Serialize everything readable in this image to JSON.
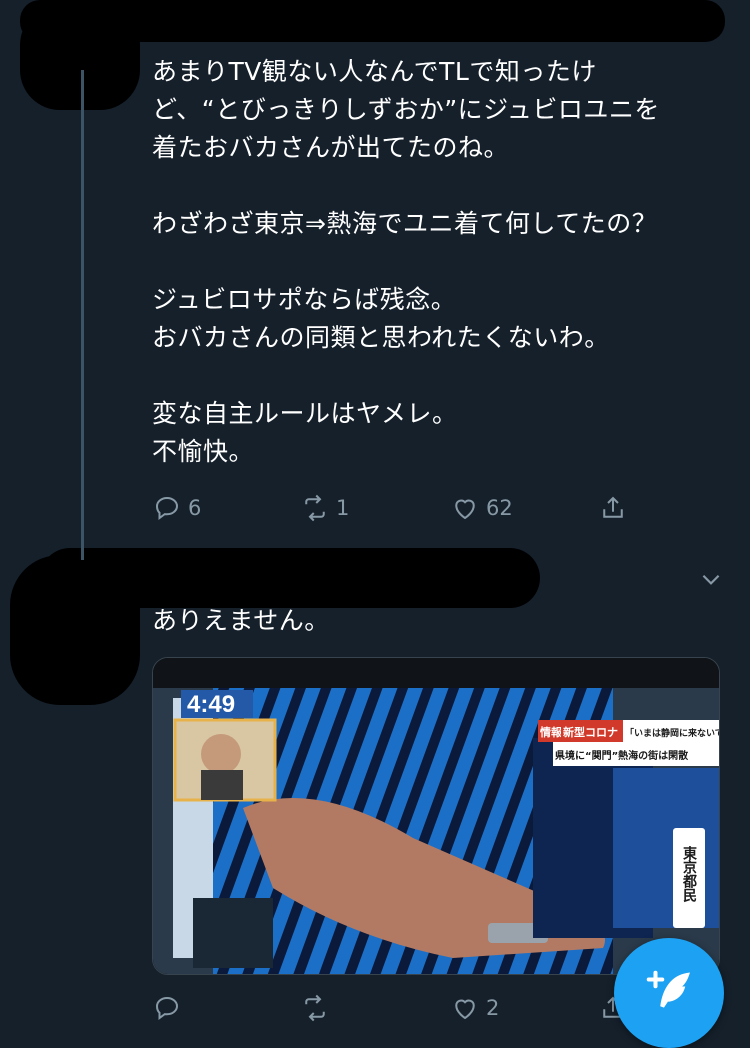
{
  "tweet1": {
    "text": "あまりTV観ない人なんでTLで知ったけ\nど、“とびっきりしずおか”にジュビロユニを\n着たおバカさんが出てたのね。\n\nわざわざ東京⇒熱海でユニ着て何してたの？\n\nジュビロサポならば残念。\nおバカさんの同類と思われたくないわ。\n\n変な自主ルールはヤメレ。\n不愉快。",
    "reply_count": "6",
    "retweet_count": "1",
    "like_count": "62"
  },
  "tweet2": {
    "text": "ありえません。",
    "reply_count": "",
    "retweet_count": "",
    "like_count": "2",
    "media": {
      "clock": "4:49",
      "caption_tag1": "情報",
      "caption_tag2": "新型コロナ",
      "caption_quote": "「いまは静岡に来ないで」",
      "caption_line2": "県境に“関門”熱海の街は閑散",
      "side_label": "東京都民"
    }
  },
  "icons": {
    "reply": "reply-icon",
    "retweet": "retweet-icon",
    "like": "heart-icon",
    "share": "share-icon",
    "more": "chevron-down-icon",
    "compose": "compose-tweet-icon"
  },
  "colors": {
    "background": "#15202b",
    "text": "#ffffff",
    "secondary": "#8899a6",
    "accent": "#1da1f2"
  }
}
